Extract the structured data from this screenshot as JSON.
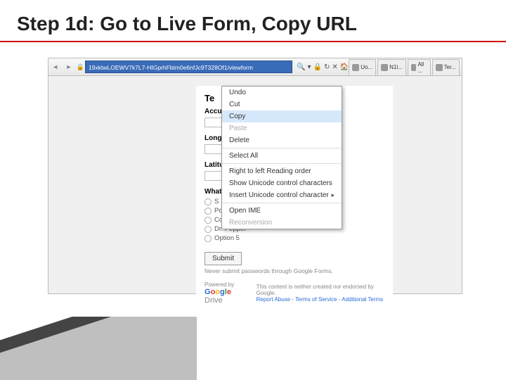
{
  "slide": {
    "title": "Step 1d: Go to Live Form, Copy URL"
  },
  "browser": {
    "url": "19xktwLOEWV7k7L7-HIGprhFbtm0e6nfJc9T328Of1/viewform",
    "toolbar_search_icon": "🔍",
    "tabs": [
      {
        "label": "Uo..."
      },
      {
        "label": "N1l..."
      },
      {
        "label": "All ..."
      },
      {
        "label": "Ter..."
      }
    ]
  },
  "context_menu": {
    "items": [
      {
        "label": "Undo",
        "enabled": true
      },
      {
        "label": "Cut",
        "enabled": true
      },
      {
        "label": "Copy",
        "enabled": true,
        "selected": true
      },
      {
        "label": "Paste",
        "enabled": false
      },
      {
        "label": "Delete",
        "enabled": true
      },
      {
        "sep": true
      },
      {
        "label": "Select All",
        "enabled": true
      },
      {
        "sep": true
      },
      {
        "label": "Right to left Reading order",
        "enabled": true
      },
      {
        "label": "Show Unicode control characters",
        "enabled": true
      },
      {
        "label": "Insert Unicode control character",
        "enabled": true,
        "submenu": true
      },
      {
        "sep": true
      },
      {
        "label": "Open IME",
        "enabled": true
      },
      {
        "label": "Reconversion",
        "enabled": false
      }
    ]
  },
  "form": {
    "title_truncated": "Te",
    "fields": {
      "accuracy": "Accu",
      "longitude": "Long",
      "latitude": "Latitu",
      "choice_q": "What"
    },
    "options": [
      "S",
      "Pop",
      "Coke",
      "Dr. Pepper",
      "Option 5"
    ],
    "submit": "Submit",
    "note": "Never submit passwords through Google Forms.",
    "powered": "Powered by",
    "drive": "Drive",
    "footer_notice": "This content is neither created nor endorsed by Google.",
    "footer_links": "Report Abuse - Terms of Service - Additional Terms"
  }
}
